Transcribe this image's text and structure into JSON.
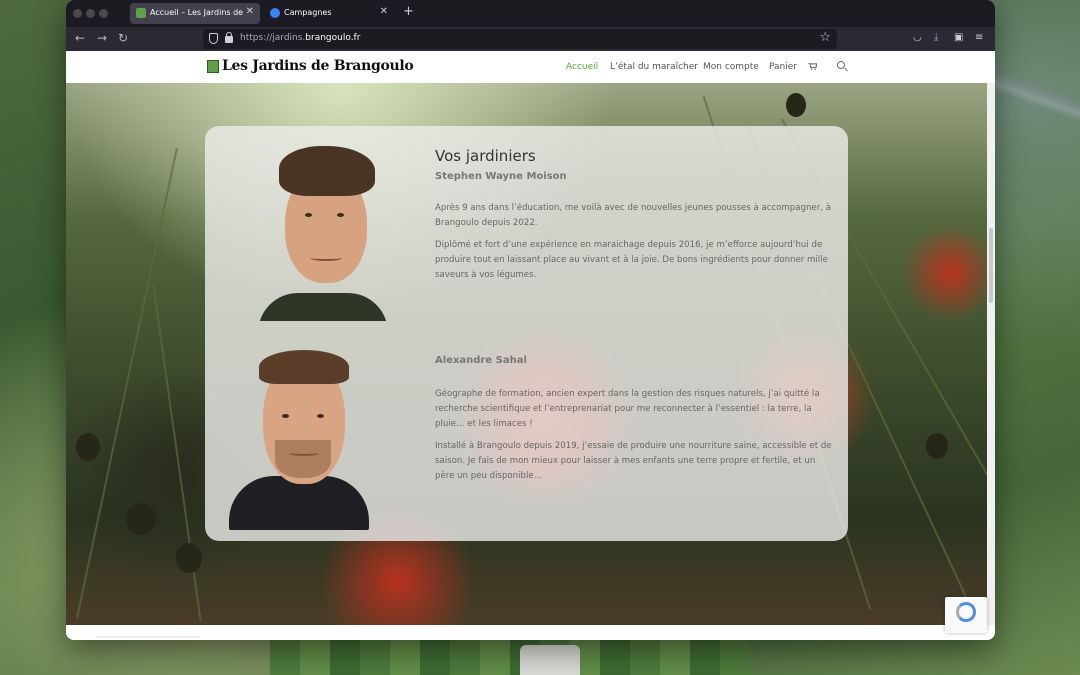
{
  "browser": {
    "tabs": [
      {
        "title": "Accueil – Les Jardins de Brangoulo",
        "active": true,
        "icon_color": "#5fa04a"
      },
      {
        "title": "Campagnes",
        "active": false,
        "icon_color": "#3b82f6"
      }
    ],
    "new_tab_icon": "plus-icon",
    "url_prefix": "https://jardins.",
    "url_domain": "brangoulo.fr"
  },
  "site": {
    "logo_text": "Les Jardins de Brangoulo",
    "menu": [
      "Accueil",
      "L’étal du maraîcher",
      "Mon compte",
      "Panier"
    ],
    "accent_color": "#5fa33a"
  },
  "gardeners": {
    "title": "Vos jardiniers",
    "people": [
      {
        "name": "Stephen Wayne Moison",
        "paragraphs": [
          "Après 9 ans dans l’éducation, me voilà avec de nouvelles jeunes pousses à accompagner, à Brangoulo depuis 2022.",
          "Diplômé et fort d’une expérience en maraichage depuis 2016, je m’efforce aujourd’hui de produire tout en laissant place au vivant et à la joie. De bons ingrédients pour donner mille saveurs à vos légumes."
        ]
      },
      {
        "name": "Alexandre Sahal",
        "paragraphs": [
          "Géographe de formation, ancien expert dans la gestion des risques naturels, j’ai quitté la recherche scientifique et l’entreprenariat pour me reconnecter à l’essentiel : la terre, la pluie… et les limaces !",
          "Installé à Brangoulo depuis 2019, j’essaie de produire une nourriture saine, accessible et de saison. Je fais de mon mieux pour laisser à mes enfants une terre propre et fertile, et un père un peu disponible…"
        ]
      }
    ]
  }
}
